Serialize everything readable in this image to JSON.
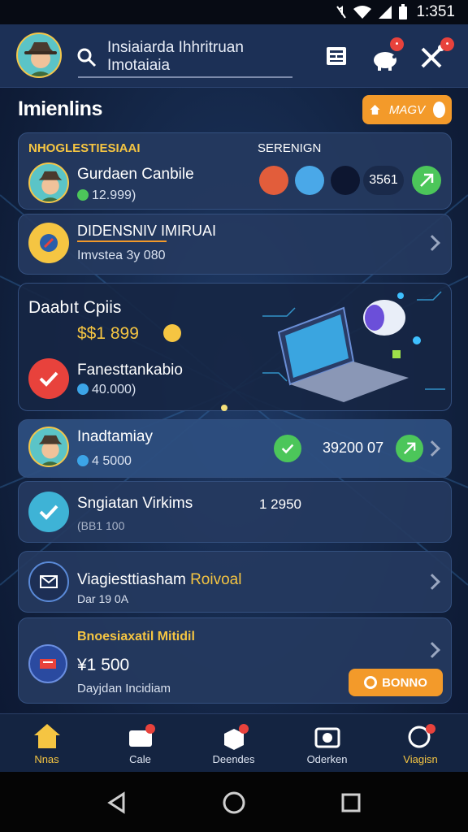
{
  "status_bar": {
    "time": "1:351"
  },
  "header": {
    "search_line1": "Insiaiarda Ihhritruan",
    "search_line2": "Imotaiaia",
    "icons": [
      "search-icon",
      "news-icon",
      "piggy-bank-icon",
      "tools-icon"
    ]
  },
  "section": {
    "title": "Imienlins",
    "new_label": "MAGV"
  },
  "card1": {
    "label_left": "NHOGLESTIESIAAI",
    "label_right": "SERENIGN",
    "name": "Gurdaen Canbile",
    "amount": "12.999)",
    "badge_value": "3561"
  },
  "card2": {
    "title": "DIDENSNIV IMIRUAI",
    "subtitle": "Imvstea 3y 080"
  },
  "promo": {
    "title": "Daabıt Cpiis",
    "amount": "$$1 899",
    "item_name": "Fanesttankabio",
    "item_amount": "40.000)"
  },
  "card3": {
    "name": "Inadtamiay",
    "amount": "4 5000",
    "value": "39200 07"
  },
  "card4": {
    "name": "Sngiatan Virkims",
    "value": "1 2950",
    "subtitle": "(BB1 100"
  },
  "card5": {
    "title_white": "Viagiesttiasham",
    "title_gold": "Roivoal",
    "subtitle": "Dar 19 0A"
  },
  "card6": {
    "label": "Bnoesiaxatil Mitidil",
    "amount": "¥1 500",
    "subtitle": "Dayjdan Incidiam",
    "button_label": "BONNO"
  },
  "nav": {
    "items": [
      {
        "label": "Nnas",
        "active": true
      },
      {
        "label": "Cale",
        "active": false
      },
      {
        "label": "Deendes",
        "active": false
      },
      {
        "label": "Oderken",
        "active": false
      },
      {
        "label": "Viagisn",
        "active": true
      }
    ]
  },
  "colors": {
    "accent": "#f39a2a",
    "gold": "#f5c542",
    "success": "#4cc65a",
    "danger": "#e8423c",
    "card": "#25395f"
  }
}
